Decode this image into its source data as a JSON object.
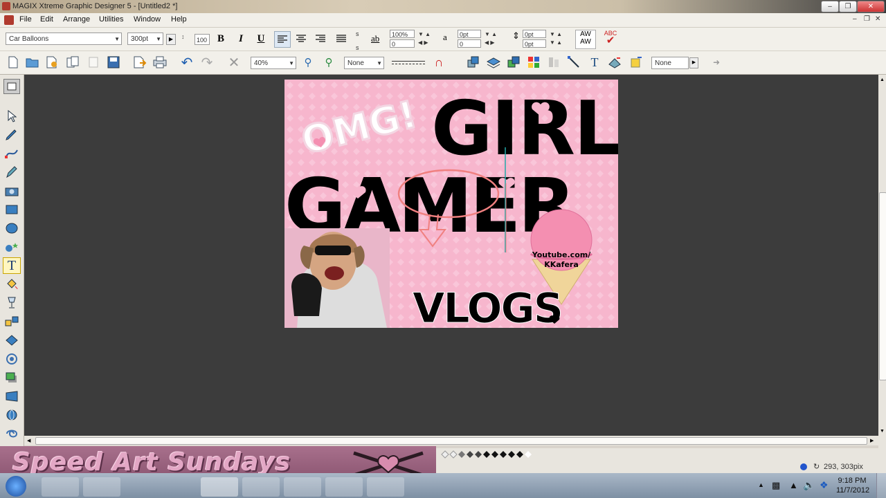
{
  "window": {
    "title": "MAGIX Xtreme Graphic Designer 5 - [Untitled2 *]",
    "controls": [
      "minimize",
      "restore",
      "close"
    ]
  },
  "menubar": [
    "File",
    "Edit",
    "Arrange",
    "Utilities",
    "Window",
    "Help"
  ],
  "toolbar1": {
    "font_name": "Car Balloons",
    "font_size": "300pt",
    "aspect_value": "100",
    "bold": "B",
    "italic": "I",
    "underline": "U",
    "char_width": "100%",
    "char_width2": "0",
    "baseline1": "0pt",
    "baseline2": "0",
    "spacing1": "0pt",
    "spacing2": "0pt",
    "kern_label": "AW",
    "kern_label2": "AW",
    "spell_label": "ABC"
  },
  "toolbar2": {
    "zoom": "40%",
    "fill_none": "None",
    "shadow_none": "None"
  },
  "thumbnail": {
    "omg": "OMG!",
    "girl": "GIRL",
    "gamer": "GAMER",
    "vlogs": "VLOGS",
    "cone_line1": "Youtube.com/",
    "cone_line2": "KKafera"
  },
  "banner": {
    "text": "Speed Art Sundays"
  },
  "statusbar": {
    "coords": "293, 303pix"
  },
  "taskbar": {
    "time": "9:18 PM",
    "date": "11/7/2012"
  },
  "colors": {
    "workspace": "#3c3c3c",
    "thumb_bg": "#f7b6cd",
    "banner": "#8a5470",
    "heart": "#f48fb1"
  }
}
